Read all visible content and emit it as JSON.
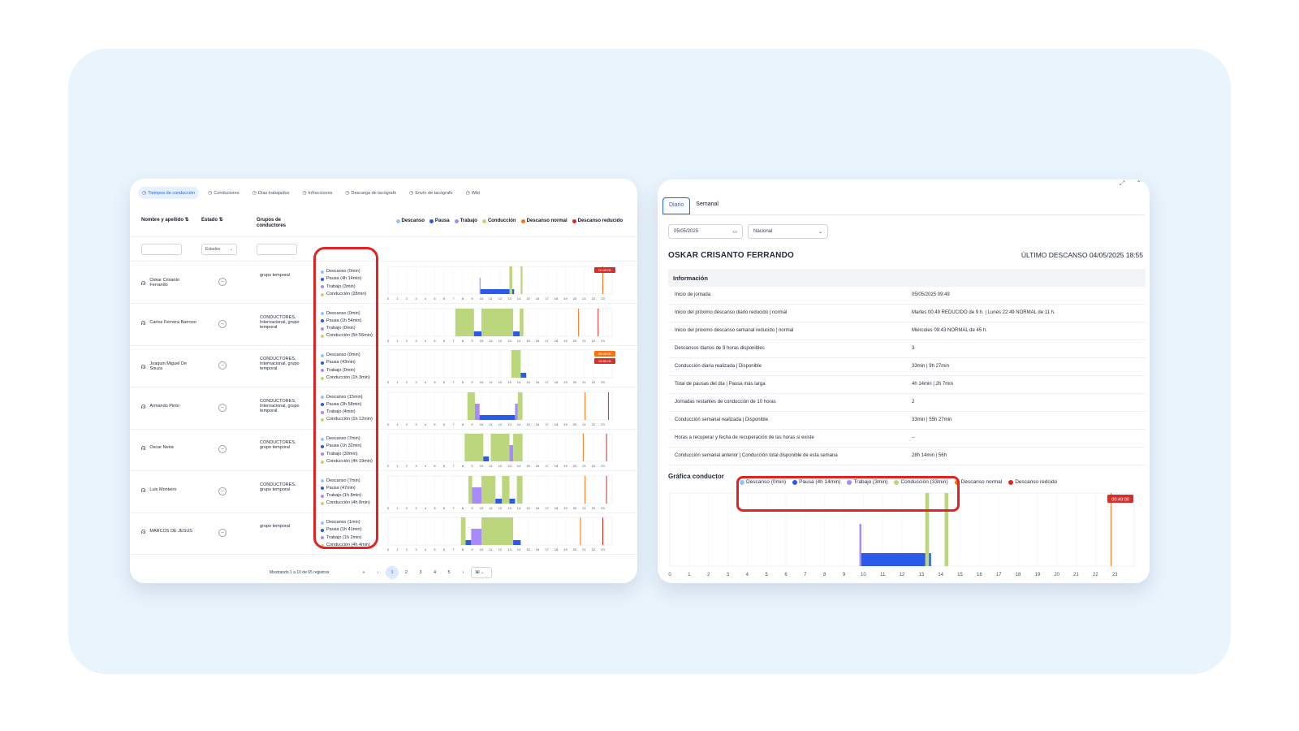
{
  "left": {
    "tabs": [
      {
        "label": "Tiempos de conducción",
        "icon": "clock-icon",
        "active": true
      },
      {
        "label": "Conductores",
        "icon": "users-icon"
      },
      {
        "label": "Días trabajados",
        "icon": "calendar-icon"
      },
      {
        "label": "Infracciones",
        "icon": "alert-icon"
      },
      {
        "label": "Descarga de tacógrafo",
        "icon": "cloud-download-icon"
      },
      {
        "label": "Envío de tacógrafo",
        "icon": "cloud-upload-icon"
      },
      {
        "label": "Wiki",
        "icon": "book-icon"
      }
    ],
    "headers": {
      "name": "Nombre y apellido ⇅",
      "estado": "Estado ⇅",
      "grupos": "Grupos de conductores"
    },
    "legend": [
      {
        "label": "Descanso",
        "color": "#93c5fd"
      },
      {
        "label": "Pausa",
        "color": "#2b59e8"
      },
      {
        "label": "Trabajo",
        "color": "#a78bfa"
      },
      {
        "label": "Conducción",
        "color": "#bcd67e"
      },
      {
        "label": "Descanso normal",
        "color": "#f97316"
      },
      {
        "label": "Descanso reducido",
        "color": "#dc2626"
      }
    ],
    "estado_filter": "Estados",
    "rows": [
      {
        "name": "Oskar Crisanto Ferrando",
        "grupo": "grupo temporal",
        "summary": [
          "Descanso (0min)",
          "Pausa (4h 14min)",
          "Trabajo (3min)",
          "Conducción (28min)"
        ],
        "segments": [
          {
            "t": "trabajo",
            "s": 9.8,
            "e": 9.9
          },
          {
            "t": "pausa",
            "s": 9.9,
            "e": 13.5
          },
          {
            "t": "conduccion",
            "s": 13.0,
            "e": 13.3
          },
          {
            "t": "conduccion",
            "s": 14.2,
            "e": 14.4
          }
        ],
        "markers": [
          {
            "t": "normal",
            "h": 23.0
          }
        ],
        "badges": [
          "00:49:00"
        ]
      },
      {
        "name": "Carlos Ferreira Barroso",
        "grupo": "CONDUCTORES, Internacional, grupo temporal",
        "summary": [
          "Descanso (0min)",
          "Pausa (1h 54min)",
          "Trabajo (0min)",
          "Conducción (5h 56min)"
        ],
        "segments": [
          {
            "t": "conduccion",
            "s": 7.2,
            "e": 9.2
          },
          {
            "t": "pausa",
            "s": 9.2,
            "e": 10.0
          },
          {
            "t": "conduccion",
            "s": 10.0,
            "e": 13.4
          },
          {
            "t": "pausa",
            "s": 13.4,
            "e": 14.1
          },
          {
            "t": "conduccion",
            "s": 14.1,
            "e": 14.5
          }
        ],
        "markers": [
          {
            "t": "normal",
            "h": 20.4
          },
          {
            "t": "reducido",
            "h": 22.5
          }
        ],
        "badges": []
      },
      {
        "name": "Joaquin Miguel De Souza",
        "grupo": "CONDUCTORES, Internacional, grupo temporal",
        "summary": [
          "Descanso (0min)",
          "Pausa (43min)",
          "Trabajo (0min)",
          "Conducción (1h 3min)"
        ],
        "segments": [
          {
            "t": "conduccion",
            "s": 13.2,
            "e": 14.2
          },
          {
            "t": "pausa",
            "s": 14.2,
            "e": 14.8
          }
        ],
        "markers": [],
        "badges": [
          "06:49:00",
          "22:50:00"
        ]
      },
      {
        "name": "Armando Pinto",
        "grupo": "CONDUCTORES, Internacional, grupo temporal",
        "summary": [
          "Descanso (15min)",
          "Pausa (3h 58min)",
          "Trabajo (4min)",
          "Conducción (1h 12min)"
        ],
        "segments": [
          {
            "t": "conduccion",
            "s": 8.5,
            "e": 9.3
          },
          {
            "t": "trabajo",
            "s": 9.3,
            "e": 9.8
          },
          {
            "t": "pausa",
            "s": 9.8,
            "e": 13.6
          },
          {
            "t": "trabajo",
            "s": 13.6,
            "e": 13.9
          },
          {
            "t": "conduccion",
            "s": 13.9,
            "e": 14.4
          }
        ],
        "markers": [
          {
            "t": "normal",
            "h": 21.1
          },
          {
            "t": "reducido",
            "h": 23.6
          }
        ],
        "badges": []
      },
      {
        "name": "Oscar Neira",
        "grupo": "CONDUCTORES, grupo temporal",
        "summary": [
          "Descanso (7min)",
          "Pausa (1h 32min)",
          "Trabajo (30min)",
          "Conducción (4h 19min)"
        ],
        "segments": [
          {
            "t": "conduccion",
            "s": 8.2,
            "e": 10.2
          },
          {
            "t": "pausa",
            "s": 10.2,
            "e": 10.8
          },
          {
            "t": "conduccion",
            "s": 11.0,
            "e": 13.0
          },
          {
            "t": "trabajo",
            "s": 13.0,
            "e": 13.4
          },
          {
            "t": "conduccion",
            "s": 13.4,
            "e": 14.4
          }
        ],
        "markers": [
          {
            "t": "normal",
            "h": 20.9
          },
          {
            "t": "reducido",
            "h": 23.4
          }
        ],
        "badges": []
      },
      {
        "name": "Luis Monteiro",
        "grupo": "CONDUCTORES, grupo temporal",
        "summary": [
          "Descanso (7min)",
          "Pausa (47min)",
          "Trabajo (1h 8min)",
          "Conducción (4h 8min)"
        ],
        "segments": [
          {
            "t": "conduccion",
            "s": 8.6,
            "e": 9.0
          },
          {
            "t": "trabajo",
            "s": 9.0,
            "e": 10.0
          },
          {
            "t": "conduccion",
            "s": 10.0,
            "e": 11.5
          },
          {
            "t": "pausa",
            "s": 11.5,
            "e": 12.2
          },
          {
            "t": "conduccion",
            "s": 12.2,
            "e": 13.0
          },
          {
            "t": "pausa",
            "s": 13.0,
            "e": 13.6
          },
          {
            "t": "conduccion",
            "s": 13.8,
            "e": 14.4
          }
        ],
        "markers": [
          {
            "t": "normal",
            "h": 21.1
          },
          {
            "t": "reducido",
            "h": 23.4
          }
        ],
        "badges": []
      },
      {
        "name": "MARCOS DE JESUS",
        "grupo": "grupo temporal",
        "summary": [
          "Descanso (1min)",
          "Pausa (1h 41min)",
          "Trabajo (1h 2min)",
          "Conducción (4h 4min)"
        ],
        "segments": [
          {
            "t": "conduccion",
            "s": 7.8,
            "e": 8.3
          },
          {
            "t": "pausa",
            "s": 8.3,
            "e": 8.9
          },
          {
            "t": "trabajo",
            "s": 8.9,
            "e": 10.0
          },
          {
            "t": "conduccion",
            "s": 10.0,
            "e": 13.4
          },
          {
            "t": "pausa",
            "s": 13.4,
            "e": 14.2
          }
        ],
        "markers": [
          {
            "t": "normal",
            "h": 20.6
          },
          {
            "t": "reducido",
            "h": 23.0
          }
        ],
        "badges": []
      }
    ],
    "pager": {
      "text": "Mostrando 1 a 10 de 65 registros",
      "pages": [
        "«",
        "‹",
        "1",
        "2",
        "3",
        "4",
        "5",
        "›",
        "»"
      ],
      "active": "1",
      "size": "10"
    }
  },
  "right": {
    "tabs": [
      "Diario",
      "Semanal"
    ],
    "date": "05/05/2025",
    "region": "Nacional",
    "driver": "OSKAR CRISANTO FERRANDO",
    "last_rest": "ÚLTIMO DESCANSO 04/05/2025 18:55",
    "info_title": "Información",
    "info_rows": [
      {
        "k": "Inicio de jornada",
        "v": "05/05/2025 09:49"
      },
      {
        "k": "Inicio del próximo descanso diario reducido | normal",
        "v": "Martes 00:49 REDUCIDO de 9 h. | Lunes 22:49 NORMAL de 11 h."
      },
      {
        "k": "Inicio del próximo descanso semanal reducido | normal",
        "v": "Miércoles 09:43 NORMAL de 45 h."
      },
      {
        "k": "Descansos diarios de 9 horas disponibles",
        "v": "3"
      },
      {
        "k": "Conducción diaria realizada | Disponible",
        "v": "33min | 9h 27min"
      },
      {
        "k": "Total de pausas del día | Pausa más larga",
        "v": "4h 14min | 2h 7min"
      },
      {
        "k": "Jornadas restantes de conducción de 10 horas",
        "v": "2"
      },
      {
        "k": "Conducción semanal realizada | Disponible",
        "v": "33min | 55h 27min"
      },
      {
        "k": "Horas a recuperar y fecha de recuperación de las horas si existe",
        "v": "--"
      },
      {
        "k": "Conducción semanal anterior | Conducción total disponible de esta semana",
        "v": "28h 14min | 56h"
      }
    ],
    "graph_title": "Gráfica conductor",
    "graph_legend": [
      {
        "label": "Descanso (0min)",
        "color": "#93c5fd"
      },
      {
        "label": "Pausa (4h 14min)",
        "color": "#2b59e8"
      },
      {
        "label": "Trabajo (3min)",
        "color": "#a78bfa"
      },
      {
        "label": "Conducción (33min)",
        "color": "#bcd67e"
      },
      {
        "label": "Descanso normal",
        "color": "#f97316"
      },
      {
        "label": "Descanso redcido",
        "color": "#dc2626"
      }
    ],
    "graph": {
      "segments": [
        {
          "t": "trabajo",
          "s": 9.8,
          "e": 9.9
        },
        {
          "t": "pausa",
          "s": 9.9,
          "e": 13.5
        },
        {
          "t": "conduccion",
          "s": 13.2,
          "e": 13.4
        },
        {
          "t": "conduccion",
          "s": 14.2,
          "e": 14.4
        }
      ],
      "markers": [
        {
          "t": "normal",
          "h": 22.8
        }
      ],
      "badge": "00:49:00"
    }
  },
  "hours": [
    "0",
    "1",
    "2",
    "3",
    "4",
    "5",
    "6",
    "7",
    "8",
    "9",
    "10",
    "11",
    "12",
    "13",
    "14",
    "15",
    "16",
    "17",
    "18",
    "19",
    "20",
    "21",
    "22",
    "23"
  ],
  "colors": {
    "pausa": "#2b59e8",
    "trabajo": "#a78bfa",
    "conduccion": "#bcd67e",
    "descanso": "#93c5fd",
    "normal": "#f97316",
    "reducido": "#dc2626",
    "badge": "#d32f2f"
  }
}
